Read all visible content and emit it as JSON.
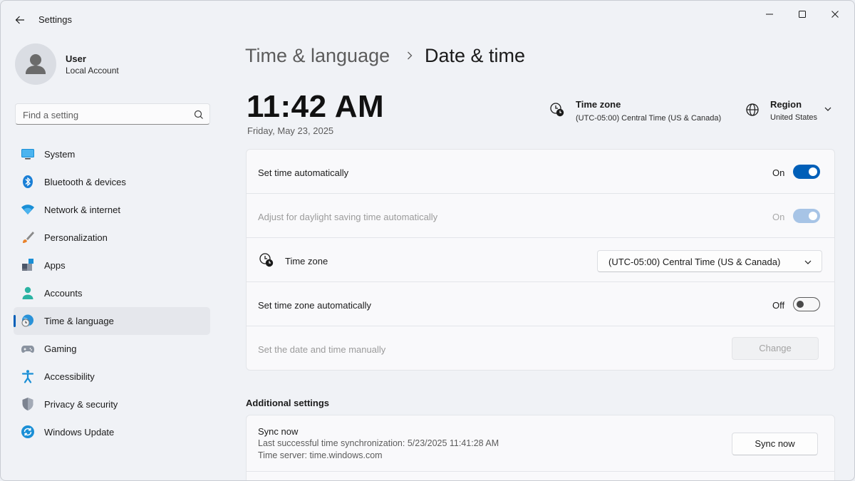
{
  "window": {
    "title": "Settings"
  },
  "profile": {
    "name": "User",
    "account_type": "Local Account"
  },
  "search": {
    "placeholder": "Find a setting"
  },
  "sidebar": {
    "items": [
      {
        "label": "System",
        "icon": "system-icon"
      },
      {
        "label": "Bluetooth & devices",
        "icon": "bluetooth-icon"
      },
      {
        "label": "Network & internet",
        "icon": "wifi-icon"
      },
      {
        "label": "Personalization",
        "icon": "brush-icon"
      },
      {
        "label": "Apps",
        "icon": "apps-icon"
      },
      {
        "label": "Accounts",
        "icon": "person-icon"
      },
      {
        "label": "Time & language",
        "icon": "globe-clock-icon",
        "selected": true
      },
      {
        "label": "Gaming",
        "icon": "controller-icon"
      },
      {
        "label": "Accessibility",
        "icon": "accessibility-icon"
      },
      {
        "label": "Privacy & security",
        "icon": "shield-icon"
      },
      {
        "label": "Windows Update",
        "icon": "update-icon"
      }
    ]
  },
  "breadcrumb": {
    "parent": "Time & language",
    "current": "Date & time"
  },
  "clock": {
    "time": "11:42 AM",
    "date": "Friday, May 23, 2025"
  },
  "summary": {
    "timezone_title": "Time zone",
    "timezone_value": "(UTC-05:00) Central Time (US & Canada)",
    "region_title": "Region",
    "region_value": "United States"
  },
  "settings": {
    "set_time_auto": {
      "label": "Set time automatically",
      "state": "On"
    },
    "daylight_saving": {
      "label": "Adjust for daylight saving time automatically",
      "state": "On"
    },
    "time_zone": {
      "label": "Time zone",
      "value": "(UTC-05:00) Central Time (US & Canada)"
    },
    "set_tz_auto": {
      "label": "Set time zone automatically",
      "state": "Off"
    },
    "manual": {
      "label": "Set the date and time manually",
      "button": "Change"
    }
  },
  "additional": {
    "heading": "Additional settings",
    "sync_title": "Sync now",
    "last_sync": "Last successful time synchronization: 5/23/2025 11:41:28 AM",
    "server": "Time server: time.windows.com",
    "sync_button": "Sync now"
  },
  "colors": {
    "accent": "#005fb8",
    "background": "#f0f2f6",
    "card": "#f9f9fb"
  }
}
